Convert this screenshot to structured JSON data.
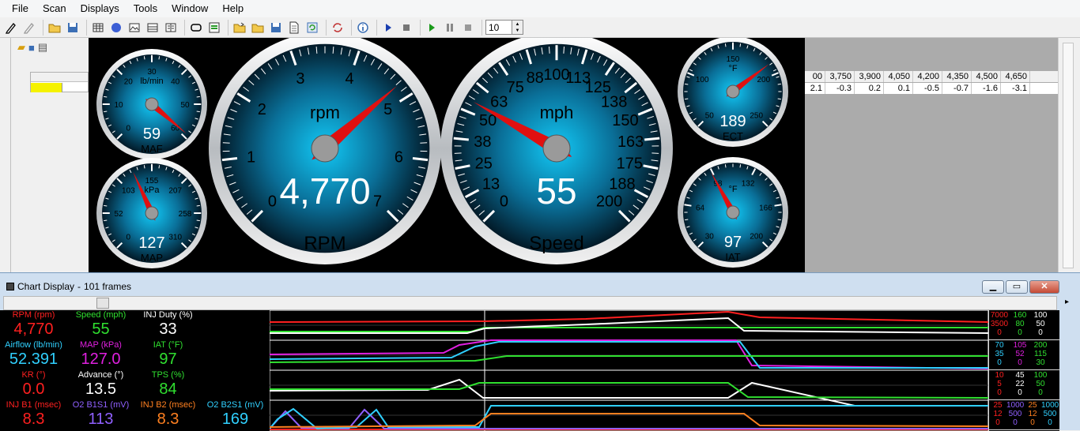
{
  "menu": [
    "File",
    "Scan",
    "Displays",
    "Tools",
    "Window",
    "Help"
  ],
  "toolbar": {
    "icons": [
      "pencil-icon",
      "pencil-gray-icon",
      "open-folder-icon",
      "save-icon",
      "grid-icon",
      "globe-icon",
      "image-icon",
      "table-icon",
      "split-icon",
      "record-icon",
      "file-filter-icon",
      "open-file-icon",
      "folder-icon",
      "save-disk-icon",
      "document-icon",
      "refresh-icon",
      "sync-icon",
      "info-icon",
      "play-blue-icon",
      "stop-icon",
      "play-green-icon",
      "pause-icon",
      "stop-gray-icon"
    ],
    "frame_count": "10"
  },
  "report": {
    "columns": [
      "00",
      "3,750",
      "3,900",
      "4,050",
      "4,200",
      "4,350",
      "4,500",
      "4,650"
    ],
    "values": [
      "2.1",
      "-0.3",
      "0.2",
      "0.1",
      "-0.5",
      "-0.7",
      "-1.6",
      "-3.1"
    ]
  },
  "gauges": {
    "maf": {
      "title": "lb/min",
      "label": "MAF",
      "value": "59",
      "ticks": [
        "0",
        "10",
        "20",
        "30",
        "40",
        "50",
        "60"
      ],
      "reading": 59,
      "min": 0,
      "max": 60
    },
    "map": {
      "title": "kPa",
      "label": "MAP",
      "value": "127",
      "ticks": [
        "0",
        "52",
        "103",
        "155",
        "207",
        "258",
        "310"
      ],
      "reading": 127,
      "min": 0,
      "max": 310
    },
    "rpm": {
      "title": "rpm",
      "label": "RPM",
      "value": "4,770",
      "ticks": [
        "0",
        "1",
        "2",
        "3",
        "4",
        "5",
        "6",
        "7"
      ],
      "reading": 4.77,
      "min": 0,
      "max": 7
    },
    "speed": {
      "title": "mph",
      "label": "Speed",
      "value": "55",
      "ticks": [
        "0",
        "13",
        "25",
        "38",
        "50",
        "63",
        "75",
        "88",
        "100",
        "113",
        "125",
        "138",
        "150",
        "163",
        "175",
        "188",
        "200"
      ],
      "reading": 55,
      "min": 0,
      "max": 200
    },
    "ect": {
      "title": "°F",
      "label": "ECT",
      "value": "189",
      "ticks": [
        "50",
        "100",
        "150",
        "200",
        "250"
      ],
      "reading": 189,
      "min": 50,
      "max": 250
    },
    "iat": {
      "title": "°F",
      "label": "IAT",
      "value": "97",
      "ticks": [
        "30",
        "64",
        "98",
        "132",
        "166",
        "200"
      ],
      "reading": 97,
      "min": 30,
      "max": 200
    }
  },
  "chart_window": {
    "title": "Chart Display",
    "frames": "101 frames",
    "params": [
      {
        "label": "RPM (rpm)",
        "value": "4,770",
        "color": "#ff2020"
      },
      {
        "label": "Speed (mph)",
        "value": "55",
        "color": "#30e030"
      },
      {
        "label": "INJ Duty (%)",
        "value": "33",
        "color": "#ffffff"
      },
      {
        "label": "Airflow (lb/min)",
        "value": "52.391",
        "color": "#30d0ff"
      },
      {
        "label": "MAP (kPa)",
        "value": "127.0",
        "color": "#e020e0"
      },
      {
        "label": "IAT (°F)",
        "value": "97",
        "color": "#30e030"
      },
      {
        "label": "KR (°)",
        "value": "0.0",
        "color": "#ff2020"
      },
      {
        "label": "Advance (°)",
        "value": "13.5",
        "color": "#ffffff"
      },
      {
        "label": "TPS (%)",
        "value": "84",
        "color": "#30e030"
      },
      {
        "label": "INJ B1 (msec)",
        "value": "8.3",
        "color": "#ff2020"
      },
      {
        "label": "O2 B1S1 (mV)",
        "value": "113",
        "color": "#9060ff"
      },
      {
        "label": "INJ B2 (msec)",
        "value": "8.3",
        "color": "#ff8020"
      },
      {
        "label": "O2 B2S1 (mV)",
        "value": "169",
        "color": "#30d0ff"
      }
    ],
    "scales": [
      [
        [
          "7000",
          "160",
          "100"
        ],
        [
          "3500",
          "80",
          "50"
        ],
        [
          "0",
          "0",
          "0"
        ]
      ],
      [
        [
          "70",
          "105",
          "200"
        ],
        [
          "35",
          "52",
          "115"
        ],
        [
          "0",
          "0",
          "30"
        ]
      ],
      [
        [
          "10",
          "45",
          "100"
        ],
        [
          "5",
          "22",
          "50"
        ],
        [
          "0",
          "0",
          "0"
        ]
      ],
      [
        [
          "25",
          "1000",
          "25",
          "1000"
        ],
        [
          "12",
          "500",
          "12",
          "500"
        ],
        [
          "0",
          "0",
          "0",
          "0"
        ]
      ]
    ],
    "scale_colors": [
      [
        "#ff2020",
        "#30e030",
        "#ffffff"
      ],
      [
        "#30d0ff",
        "#e020e0",
        "#30e030"
      ],
      [
        "#ff2020",
        "#ffffff",
        "#30e030"
      ],
      [
        "#ff2020",
        "#9060ff",
        "#ff8020",
        "#30d0ff"
      ]
    ]
  }
}
